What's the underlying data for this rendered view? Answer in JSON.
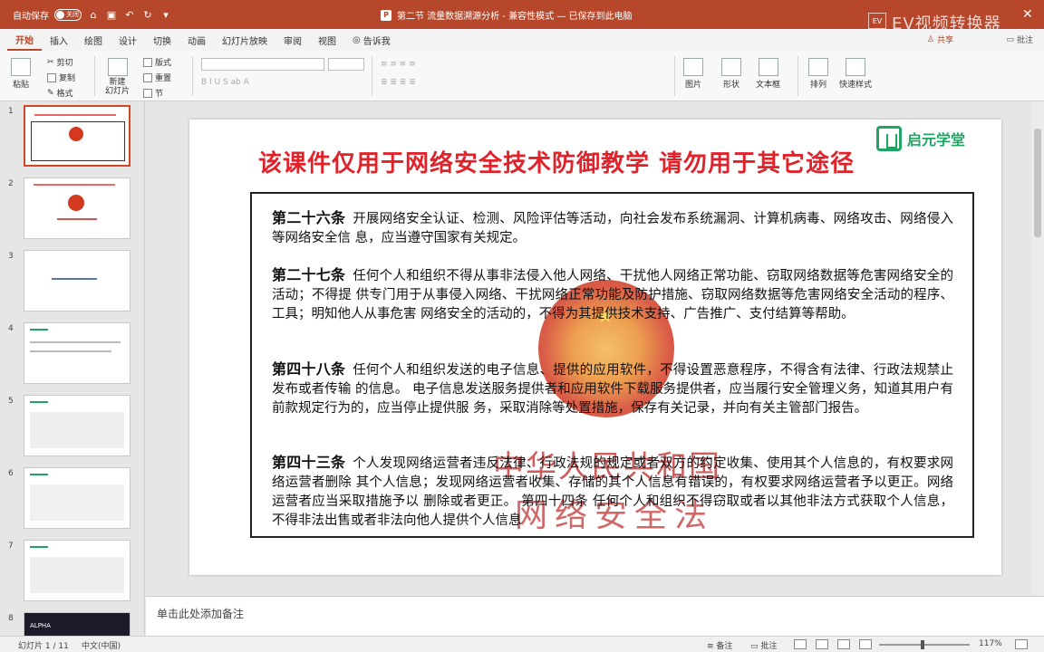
{
  "titlebar": {
    "autosave_label": "自动保存",
    "toggle_state": "关闭",
    "document_title": "第二节 流量数据溯源分析 - 兼容性模式 — 已保存到此电脑",
    "watermark": "EV视频转换器",
    "watermark_box": "EV",
    "close_glyph": "✕"
  },
  "ribbon_tabs": [
    "开始",
    "插入",
    "绘图",
    "设计",
    "切换",
    "动画",
    "幻灯片放映",
    "审阅",
    "视图"
  ],
  "tell_me": "告诉我",
  "share_label": "共享",
  "comment_label": "批注",
  "ribbon": {
    "paste": "粘贴",
    "cut": "剪切",
    "copy": "复制",
    "format": "格式",
    "new_slide": "新建\n幻灯片",
    "layout": "版式",
    "reset": "重置",
    "section": "节",
    "picture": "图片",
    "shape": "形状",
    "textbox": "文本框",
    "arrange": "排列",
    "quick_styles": "快速样式"
  },
  "thumbnails": [
    {
      "num": "1",
      "selected": true
    },
    {
      "num": "2",
      "selected": false
    },
    {
      "num": "3",
      "selected": false
    },
    {
      "num": "4",
      "selected": false
    },
    {
      "num": "5",
      "selected": false
    },
    {
      "num": "6",
      "selected": false
    },
    {
      "num": "7",
      "selected": false
    },
    {
      "num": "8",
      "selected": false
    }
  ],
  "thumb8_text": "ALPHA",
  "slide": {
    "logo_text": "启元学堂",
    "warning": "该课件仅用于网络安全技术防御教学   请勿用于其它途径",
    "seal_line1": "中华人民共和国",
    "seal_line2": "网络安全法",
    "articles": [
      {
        "title": "第二十六条",
        "body": "开展网络安全认证、检测、风险评估等活动，向社会发布系统漏洞、计算机病毒、网络攻击、网络侵入等网络安全信 息，应当遵守国家有关规定。"
      },
      {
        "title": "第二十七条",
        "body": "任何个人和组织不得从事非法侵入他人网络、干扰他人网络正常功能、窃取网络数据等危害网络安全的活动；不得提 供专门用于从事侵入网络、干扰网络正常功能及防护措施、窃取网络数据等危害网络安全活动的程序、工具；明知他人从事危害 网络安全的活动的，不得为其提供技术支持、广告推广、支付结算等帮助。"
      },
      {
        "title": "第四十八条",
        "body": "任何个人和组织发送的电子信息、提供的应用软件，不得设置恶意程序，不得含有法律、行政法规禁止发布或者传输 的信息。 电子信息发送服务提供者和应用软件下载服务提供者，应当履行安全管理义务，知道其用户有前款规定行为的，应当停止提供服 务，采取消除等处置措施，保存有关记录，并向有关主管部门报告。"
      },
      {
        "title": "第四十三条",
        "body": "个人发现网络运营者违反法律、行政法规的规定或者双方的约定收集、使用其个人信息的，有权要求网络运营者删除 其个人信息；发现网络运营者收集、存储的其个人信息有错误的，有权要求网络运营者予以更正。网络运营者应当采取措施予以 删除或者更正。 第四十四条  任何个人和组织不得窃取或者以其他非法方式获取个人信息，不得非法出售或者非法向他人提供个人信息"
      }
    ]
  },
  "notes_placeholder": "单击此处添加备注",
  "status": {
    "slide_counter": "幻灯片 1 / 11",
    "language": "中文(中国)",
    "notes": "备注",
    "comments": "批注",
    "zoom": "117%"
  },
  "colors": {
    "accent": "#b7472a",
    "warning_red": "#e0232a",
    "logo_green": "#1fa463"
  }
}
